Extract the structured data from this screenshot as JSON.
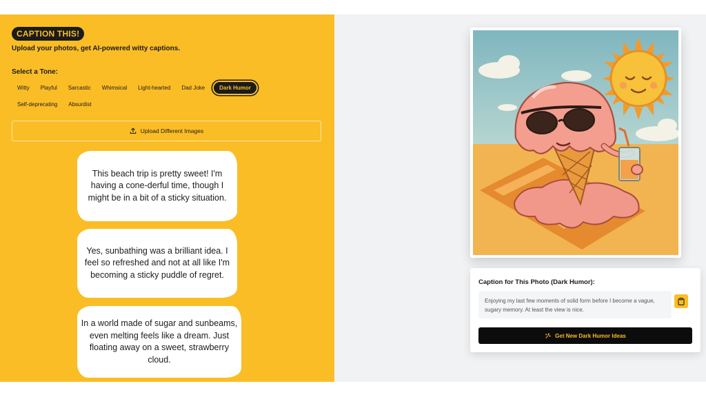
{
  "app": {
    "title": "CAPTION THIS!",
    "tagline": "Upload your photos, get AI-powered witty captions."
  },
  "tones": {
    "label": "Select a Tone:",
    "items": [
      "Witty",
      "Playful",
      "Sarcastic",
      "Whimsical",
      "Light-hearted",
      "Dad Joke",
      "Dark Humor",
      "Self-deprecating",
      "Absurdist"
    ],
    "active": "Dark Humor"
  },
  "upload": {
    "label": "Upload Different Images",
    "icon": "upload-icon"
  },
  "captions": [
    "This beach trip is pretty sweet! I'm having a cone-derful time, though I might be in a bit of a sticky situation.",
    "Yes, sunbathing was a brilliant idea. I feel so refreshed and not at all like I'm becoming a sticky puddle of regret.",
    "In a world made of sugar and sunbeams, even melting feels like a dream. Just floating away on a sweet, strawberry cloud."
  ],
  "photo": {
    "alt_icon": "melting-ice-cream-illustration"
  },
  "result": {
    "title": "Caption for This Photo (Dark Humor):",
    "text": "Enjoying my last few moments of solid form before I become a vague, sugary memory. At least the view is nice.",
    "copy_icon": "clipboard-icon",
    "generate_label": "Get New Dark Humor Ideas",
    "generate_icon": "sparkle-icon"
  },
  "colors": {
    "accent": "#fbbd26",
    "dark": "#1b1b1b",
    "panel_bg": "#f1f2f4"
  }
}
